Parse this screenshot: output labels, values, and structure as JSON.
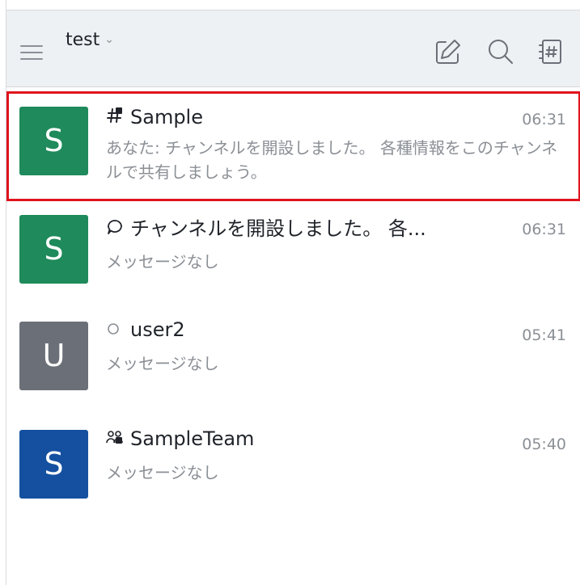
{
  "header": {
    "workspace_name": "test",
    "chevron": "⌄",
    "icons": [
      "menu-icon",
      "compose-icon",
      "search-icon",
      "channel-directory-icon"
    ]
  },
  "rooms": [
    {
      "avatar_letter": "S",
      "avatar_color": "#1f8a5b",
      "type_icon": "channel-hash-icon",
      "title": "Sample",
      "time": "06:31",
      "preview": "あなた: チャンネルを開設しました。 各種情報をこのチャンネルで共有しましょう。",
      "selected": true
    },
    {
      "avatar_letter": "S",
      "avatar_color": "#1f8a5b",
      "type_icon": "discussion-icon",
      "title": "チャンネルを開設しました。 各...",
      "time": "06:31",
      "preview": "メッセージなし",
      "selected": false
    },
    {
      "avatar_letter": "U",
      "avatar_color": "#6b7078",
      "type_icon": "status-circle-icon",
      "title": "user2",
      "time": "05:41",
      "preview": "メッセージなし",
      "selected": false
    },
    {
      "avatar_letter": "S",
      "avatar_color": "#1550a0",
      "type_icon": "team-icon",
      "title": "SampleTeam",
      "time": "05:40",
      "preview": "メッセージなし",
      "selected": false
    }
  ]
}
